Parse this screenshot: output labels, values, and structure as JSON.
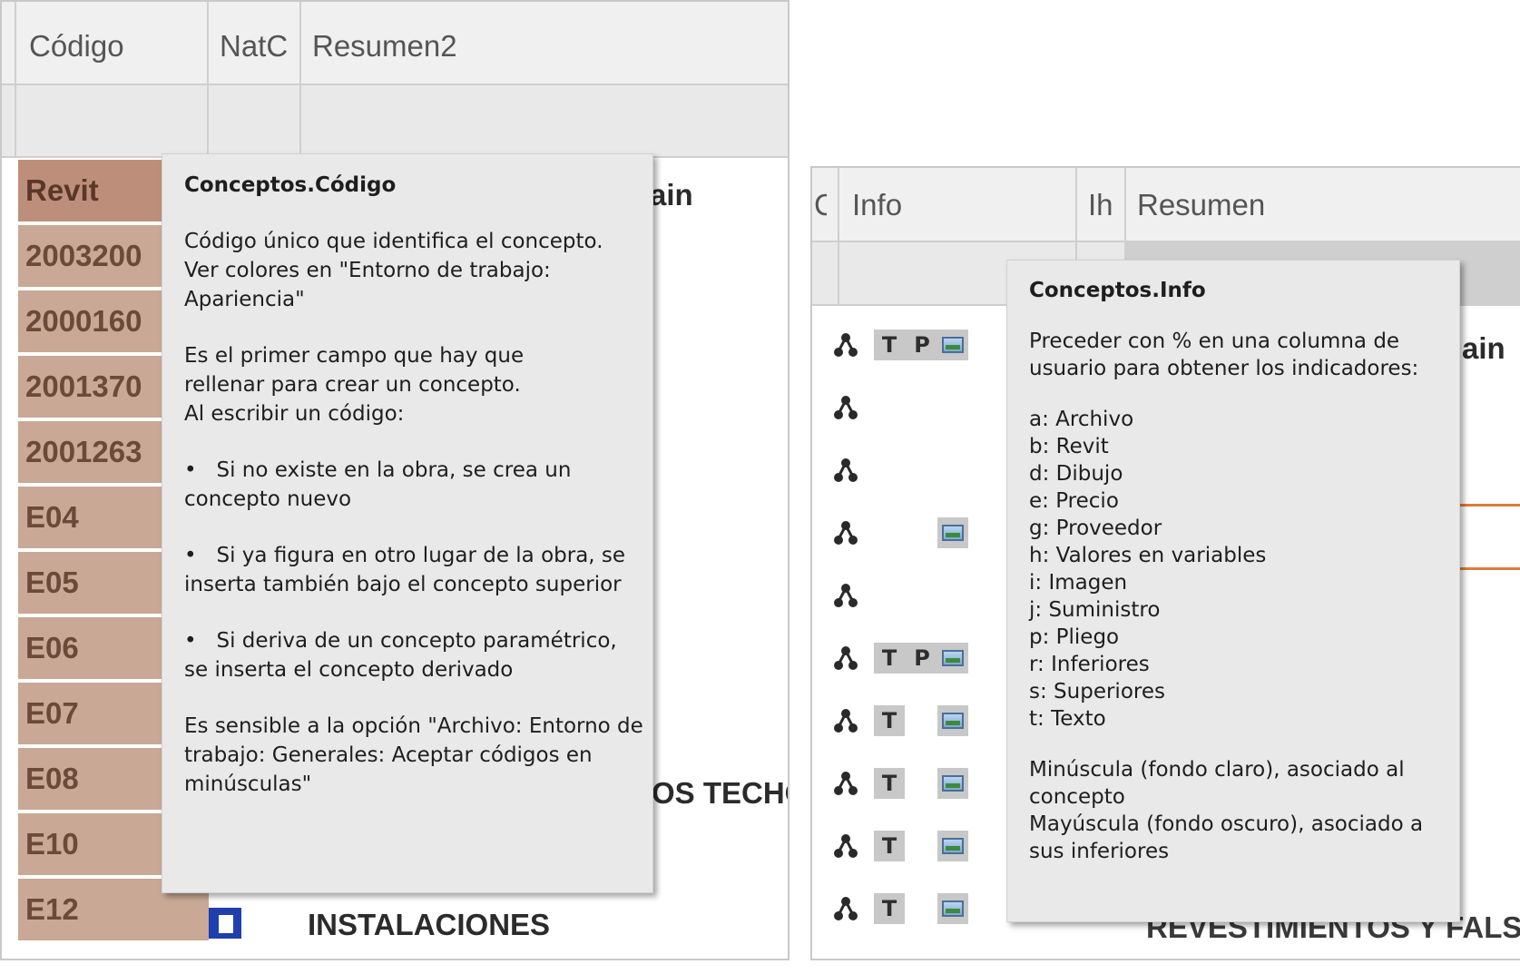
{
  "left": {
    "headers": {
      "codigo": "Código",
      "natc": "NatC",
      "resumen2": "Resumen2"
    },
    "codes": [
      "Revit",
      "2003200",
      "2000160",
      "2001370",
      "2001263",
      "E04",
      "E05",
      "E06",
      "E07",
      "E08",
      "E10",
      "E12"
    ],
    "background_text": {
      "top_right": "ain",
      "mid_right": "OS TECHO",
      "bottom_summary": "INSTALACIONES"
    },
    "tooltip": {
      "title": "Conceptos.Código",
      "p1": "Código único que identifica el concepto. Ver colores en \"Entorno de trabajo: Apariencia\"",
      "p2a": "Es el primer campo que hay que",
      "p2b": "rellenar para crear un concepto.",
      "p2c": "Al escribir un código:",
      "b1": "Si no existe en la obra, se crea un concepto nuevo",
      "b2": "Si ya figura en otro lugar de la obra, se inserta también bajo el concepto superior",
      "b3": "Si deriva de un concepto paramétrico, se inserta el concepto derivado",
      "p3": "Es sensible a la opción \"Archivo: Entorno de trabajo: Generales: Aceptar códigos en minúsculas\""
    }
  },
  "right": {
    "headers": {
      "c": "C",
      "info": "Info",
      "ih": "Ih",
      "resumen": "Resumen"
    },
    "background_text": {
      "top_right": "ain",
      "bottom": "REVESTIMIENTOS Y FALSOS T"
    },
    "rows": [
      {
        "T": "T",
        "P": "P",
        "img": true
      },
      {
        "T": "",
        "P": "",
        "img": false
      },
      {
        "T": "",
        "P": "",
        "img": false
      },
      {
        "T": "",
        "P": "",
        "img": true
      },
      {
        "T": "",
        "P": "",
        "img": false
      },
      {
        "T": "T",
        "P": "P",
        "img": true
      },
      {
        "T": "T",
        "P": "",
        "img": true
      },
      {
        "T": "T",
        "P": "",
        "img": true
      },
      {
        "T": "T",
        "P": "",
        "img": true
      },
      {
        "T": "T",
        "P": "",
        "img": true
      }
    ],
    "tooltip": {
      "title": "Conceptos.Info",
      "p1a": "Preceder con % en una columna de",
      "p1b": "usuario para obtener los indicadores:",
      "items": [
        "a: Archivo",
        "b: Revit",
        "d: Dibujo",
        "e: Precio",
        "g: Proveedor",
        "h: Valores en variables",
        "i: Imagen",
        "j: Suministro",
        "p: Pliego",
        "r: Inferiores",
        "s: Superiores",
        "t: Texto"
      ],
      "p2a": "Minúscula (fondo claro), asociado al",
      "p2b": "concepto",
      "p2c": "Mayúscula (fondo oscuro), asociado a",
      "p2d": "sus inferiores"
    }
  },
  "colors": {
    "code_cell": "#c9a896",
    "code_cell_first": "#bd8f7a",
    "tooltip_bg": "#e9e9e9",
    "accent_orange": "#e07a3a",
    "doc_icon": "#1f3fae"
  }
}
